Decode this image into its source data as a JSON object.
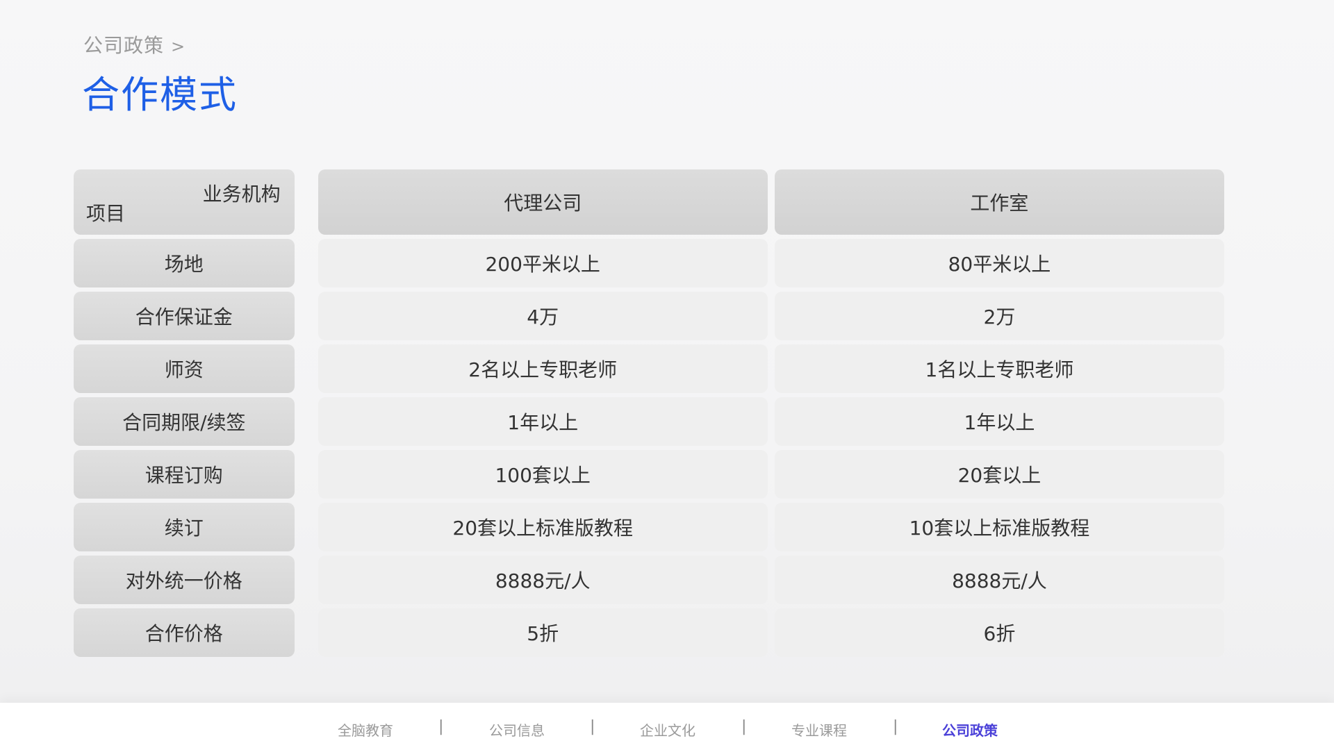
{
  "breadcrumb": {
    "parent": "公司政策",
    "separator": ">"
  },
  "title": "合作模式",
  "table": {
    "corner_top": "业务机构",
    "corner_bottom": "项目",
    "columns": [
      "代理公司",
      "工作室"
    ],
    "rows": [
      {
        "label": "场地",
        "values": [
          "200平米以上",
          "80平米以上"
        ]
      },
      {
        "label": "合作保证金",
        "values": [
          "4万",
          "2万"
        ]
      },
      {
        "label": "师资",
        "values": [
          "2名以上专职老师",
          "1名以上专职老师"
        ]
      },
      {
        "label": "合同期限/续签",
        "values": [
          "1年以上",
          "1年以上"
        ]
      },
      {
        "label": "课程订购",
        "values": [
          "100套以上",
          "20套以上"
        ]
      },
      {
        "label": "续订",
        "values": [
          "20套以上标准版教程",
          "10套以上标准版教程"
        ]
      },
      {
        "label": "对外统一价格",
        "values": [
          "8888元/人",
          "8888元/人"
        ]
      },
      {
        "label": "合作价格",
        "values": [
          "5折",
          "6折"
        ]
      }
    ]
  },
  "footer_nav": {
    "items": [
      "全脑教育",
      "公司信息",
      "企业文化",
      "专业课程",
      "公司政策"
    ],
    "separator": "|",
    "active_index": 4
  },
  "colors": {
    "title": "#1e5fe6",
    "nav_active": "#4a40d8"
  }
}
